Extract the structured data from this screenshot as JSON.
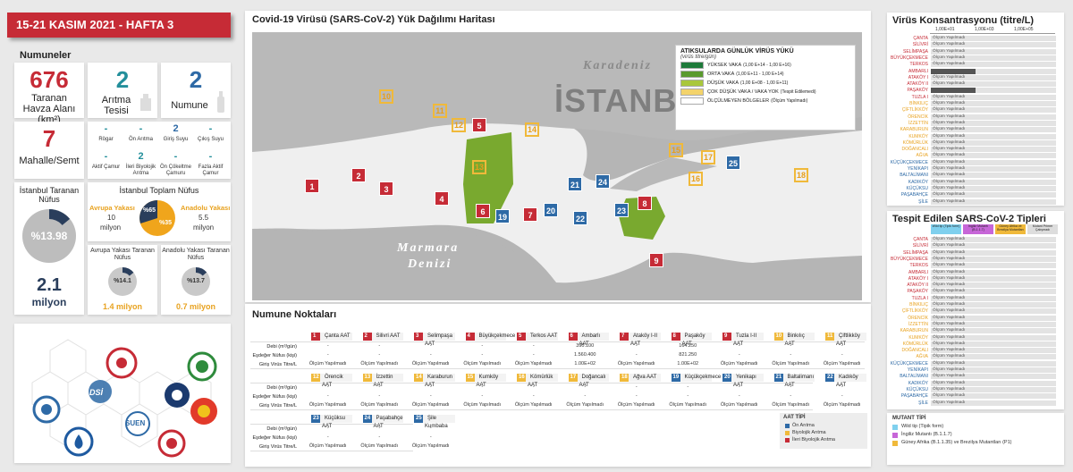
{
  "banner": "15-21 KASIM 2021 - HAFTA 3",
  "samples": {
    "title": "Numuneler",
    "area_value": "676",
    "area_label": "Taranan Havza Alanı (km²)",
    "plants_value": "2",
    "plants_label": "Arıtma Tesisi",
    "sample_value": "2",
    "sample_label": "Numune",
    "neighborhood_value": "7",
    "neighborhood_label": "Mahalle/Semt",
    "points": [
      {
        "value": "-",
        "label": "Rögar",
        "color": "teal"
      },
      {
        "value": "-",
        "label": "Ön Arıtma",
        "color": "teal"
      },
      {
        "value": "2",
        "label": "Giriş Suyu",
        "color": "blue"
      },
      {
        "value": "-",
        "label": "Çıkış Suyu",
        "color": "teal"
      },
      {
        "value": "-",
        "label": "Aktif Çamur",
        "color": "teal"
      },
      {
        "value": "2",
        "label": "İleri Biyolojik Arıtma",
        "color": "teal"
      },
      {
        "value": "-",
        "label": "Ön Çökeltme Çamuru",
        "color": "teal"
      },
      {
        "value": "-",
        "label": "Fazla Aktif Çamur",
        "color": "teal"
      }
    ]
  },
  "population": {
    "scanned_title": "İstanbul Taranan Nüfus",
    "scanned_pct": "%13.98",
    "scanned_fraction": 0.1398,
    "scanned_value": "2.1",
    "scanned_unit": "milyon",
    "total_title": "İstanbul Toplam Nüfus",
    "europe_label": "Avrupa Yakası",
    "europe_value": "10",
    "europe_unit": "milyon",
    "europe_pct": "%65",
    "asia_label": "Anadolu Yakası",
    "asia_value": "5.5",
    "asia_unit": "milyon",
    "asia_pct": "%35",
    "europe_scanned_title": "Avrupa Yakası Taranan Nüfus",
    "europe_scanned_pct": "%14.1",
    "europe_scanned_fraction": 0.141,
    "europe_scanned_value": "1.4 milyon",
    "asia_scanned_title": "Anadolu Yakası Taranan Nüfus",
    "asia_scanned_pct": "%13.7",
    "asia_scanned_fraction": 0.137,
    "asia_scanned_value": "0.7 milyon"
  },
  "logos": {
    "dsi_text": "DSİ",
    "suen_text": "SUEN"
  },
  "map": {
    "title": "Covid-19 Virüsü (SARS-CoV-2) Yük Dağılımı Haritası",
    "sea_north": "Karadeniz",
    "sea_south_1": "Marmara",
    "sea_south_2": "Denizi",
    "city": "İSTANBUL",
    "legend_title": "ATIKSULARDA GÜNLÜK VİRÜS YÜKÜ",
    "legend_subtitle": "(virüs titre/gün)",
    "legend": [
      {
        "label": "YÜKSEK VAKA",
        "range": "(1,00 E+14 - 1,00 E+16)",
        "color": "#1e7a3a"
      },
      {
        "label": "ORTA VAKA",
        "range": "(1,00 E+11 - 1,00 E+14)",
        "color": "#5a9a2e"
      },
      {
        "label": "DÜŞÜK VAKA",
        "range": "(1,00 E+08 - 1,00 E+11)",
        "color": "#a9c73c"
      },
      {
        "label": "ÇOK DÜŞÜK VAKA / VAKA YOK",
        "range": "(Tespit Edilemedi)",
        "color": "#f3d36b"
      },
      {
        "label": "ÖLÇÜLMEYEN BÖLGELER",
        "range": "(Ölçüm Yapılmadı)",
        "color": "#ffffff"
      }
    ]
  },
  "points_table": {
    "title": "Numune Noktaları",
    "row_labels": [
      "Debi (m³/gün)",
      "Eşdeğer Nüfus (kişi)",
      "Giriş Virüs Titre/L"
    ],
    "not_measured": "Ölçüm Yapılmadı",
    "stations": [
      {
        "no": "1",
        "name": "Çanta AAT",
        "type": "r",
        "vals": [
          "-",
          "-",
          "Ölçüm Yapılmadı"
        ]
      },
      {
        "no": "2",
        "name": "Silivri AAT",
        "type": "r",
        "vals": [
          "-",
          "-",
          "Ölçüm Yapılmadı"
        ]
      },
      {
        "no": "3",
        "name": "Selimpaşa AAT",
        "type": "r",
        "vals": [
          "-",
          "-",
          "Ölçüm Yapılmadı"
        ]
      },
      {
        "no": "4",
        "name": "Büyükçekmece",
        "type": "r",
        "vals": [
          "-",
          "-",
          "Ölçüm Yapılmadı"
        ]
      },
      {
        "no": "5",
        "name": "Terkos AAT",
        "type": "r",
        "vals": [
          "-",
          "-",
          "Ölçüm Yapılmadı"
        ]
      },
      {
        "no": "6",
        "name": "Ambarlı AAT",
        "type": "r",
        "vals": [
          "390.100",
          "1.560.400",
          "1.00E+02"
        ]
      },
      {
        "no": "7",
        "name": "Ataköy I-II AAT",
        "type": "r",
        "vals": [
          "-",
          "-",
          "Ölçüm Yapılmadı"
        ]
      },
      {
        "no": "8",
        "name": "Paşaköy AAT",
        "type": "r",
        "vals": [
          "164.250",
          "821.250",
          "1.00E+02"
        ]
      },
      {
        "no": "9",
        "name": "Tuzla I-II AAT",
        "type": "r",
        "vals": [
          "-",
          "-",
          "Ölçüm Yapılmadı"
        ]
      },
      {
        "no": "10",
        "name": "Binkılıç AAT",
        "type": "y",
        "vals": [
          "-",
          "-",
          "Ölçüm Yapılmadı"
        ]
      },
      {
        "no": "11",
        "name": "Çiftlikköy AAT",
        "type": "y",
        "vals": [
          "-",
          "-",
          "Ölçüm Yapılmadı"
        ]
      },
      {
        "no": "12",
        "name": "Örencik AAT",
        "type": "y",
        "vals": [
          "-",
          "-",
          "Ölçüm Yapılmadı"
        ]
      },
      {
        "no": "13",
        "name": "İzzettin AAT",
        "type": "y",
        "vals": [
          "-",
          "-",
          "Ölçüm Yapılmadı"
        ]
      },
      {
        "no": "14",
        "name": "Karaburun AAT",
        "type": "y",
        "vals": [
          "-",
          "-",
          "Ölçüm Yapılmadı"
        ]
      },
      {
        "no": "15",
        "name": "Kumköy AAT",
        "type": "y",
        "vals": [
          "-",
          "-",
          "Ölçüm Yapılmadı"
        ]
      },
      {
        "no": "16",
        "name": "Kömürlük AAT",
        "type": "y",
        "vals": [
          "-",
          "-",
          "Ölçüm Yapılmadı"
        ]
      },
      {
        "no": "17",
        "name": "Doğancalı AAT",
        "type": "y",
        "vals": [
          "-",
          "-",
          "Ölçüm Yapılmadı"
        ]
      },
      {
        "no": "18",
        "name": "Ağva AAT",
        "type": "y",
        "vals": [
          "-",
          "-",
          "Ölçüm Yapılmadı"
        ]
      },
      {
        "no": "19",
        "name": "Küçükçekmece",
        "type": "b",
        "vals": [
          "-",
          "-",
          "Ölçüm Yapılmadı"
        ]
      },
      {
        "no": "20",
        "name": "Yenikapı AAT",
        "type": "b",
        "vals": [
          "-",
          "-",
          "Ölçüm Yapılmadı"
        ]
      },
      {
        "no": "21",
        "name": "Baltalimanı AAT",
        "type": "b",
        "vals": [
          "-",
          "-",
          "Ölçüm Yapılmadı"
        ]
      },
      {
        "no": "22",
        "name": "Kadıköy AAT",
        "type": "b",
        "vals": [
          "-",
          "-",
          "Ölçüm Yapılmadı"
        ]
      },
      {
        "no": "23",
        "name": "Küçüksu AAT",
        "type": "b",
        "vals": [
          "-",
          "-",
          "Ölçüm Yapılmadı"
        ]
      },
      {
        "no": "24",
        "name": "Paşabahçe AAT",
        "type": "b",
        "vals": [
          "-",
          "-",
          "Ölçüm Yapılmadı"
        ]
      },
      {
        "no": "25",
        "name": "Şile Kumbaba",
        "type": "b",
        "vals": [
          "-",
          "-",
          "Ölçüm Yapılmadı"
        ]
      }
    ],
    "aat_title": "AAT TİPİ",
    "aat_types": [
      {
        "label": "Ön Arıtma",
        "color": "#2e6aa6"
      },
      {
        "label": "Biyolojik Arıtma",
        "color": "#f0b93a"
      },
      {
        "label": "İleri Biyolojik Arıtma",
        "color": "#c62b36"
      }
    ]
  },
  "virus_conc": {
    "title": "Virüs Konsantrasyonu (titre/L)",
    "scale": [
      "1,00E+01",
      "1,00E+03",
      "1,00E+05"
    ],
    "not_measured": "Ölçüm Yapılmadı"
  },
  "variants": {
    "title": "Tespit Edilen SARS-CoV-2 Tipleri",
    "col_heads": [
      "Wild tip (Tipik form)",
      "İngiliz Mutantı (B.1.1.7)",
      "Güney Afrika ve Brezilya Mutantları",
      "Mutant Primer Çalışmadı"
    ],
    "not_measured": "Ölçüm Yapılmadı"
  },
  "stations_list": [
    {
      "name": "ÇANTA",
      "color": "#c62b36"
    },
    {
      "name": "SİLİVRİ",
      "color": "#c62b36"
    },
    {
      "name": "SELİMPAŞA",
      "color": "#c62b36"
    },
    {
      "name": "BÜYÜKÇEKMECE",
      "color": "#c62b36"
    },
    {
      "name": "TERKOS",
      "color": "#c62b36"
    },
    {
      "name": "AMBARLI",
      "color": "#c62b36"
    },
    {
      "name": "ATAKÖY I",
      "color": "#c62b36"
    },
    {
      "name": "ATAKÖY II",
      "color": "#c62b36"
    },
    {
      "name": "PAŞAKÖY",
      "color": "#c62b36"
    },
    {
      "name": "TUZLA I",
      "color": "#c62b36"
    },
    {
      "name": "BİNKILIÇ",
      "color": "#e8a21f"
    },
    {
      "name": "ÇİFTLİKKÖY",
      "color": "#e8a21f"
    },
    {
      "name": "ÖRENCİK",
      "color": "#e8a21f"
    },
    {
      "name": "İZZETTİN",
      "color": "#e8a21f"
    },
    {
      "name": "KARABURUN",
      "color": "#e8a21f"
    },
    {
      "name": "KUMKÖY",
      "color": "#e8a21f"
    },
    {
      "name": "KÖMÜRLÜK",
      "color": "#e8a21f"
    },
    {
      "name": "DOĞANCALI",
      "color": "#e8a21f"
    },
    {
      "name": "AĞVA",
      "color": "#e8a21f"
    },
    {
      "name": "KÜÇÜKÇEKMECE",
      "color": "#2e6aa6"
    },
    {
      "name": "YENİKAPI",
      "color": "#2e6aa6"
    },
    {
      "name": "BALTALİMANI",
      "color": "#2e6aa6"
    },
    {
      "name": "KADIKÖY",
      "color": "#2e6aa6"
    },
    {
      "name": "KÜÇÜKSU",
      "color": "#2e6aa6"
    },
    {
      "name": "PAŞABAHÇE",
      "color": "#2e6aa6"
    },
    {
      "name": "ŞİLE",
      "color": "#2e6aa6"
    }
  ],
  "conc_dark_rows": [
    5,
    8
  ],
  "mutant": {
    "title": "MUTANT TİPİ",
    "items": [
      {
        "label": "Wild tip (Tipik form)",
        "color": "#7fd0ee"
      },
      {
        "label": "İngiliz Mutantı (B.1.1.7)",
        "color": "#c766d8"
      },
      {
        "label": "Güney Afrika (B.1.1.35) ve Brezilya Mutantları (P1)",
        "color": "#f0b93a"
      }
    ]
  }
}
